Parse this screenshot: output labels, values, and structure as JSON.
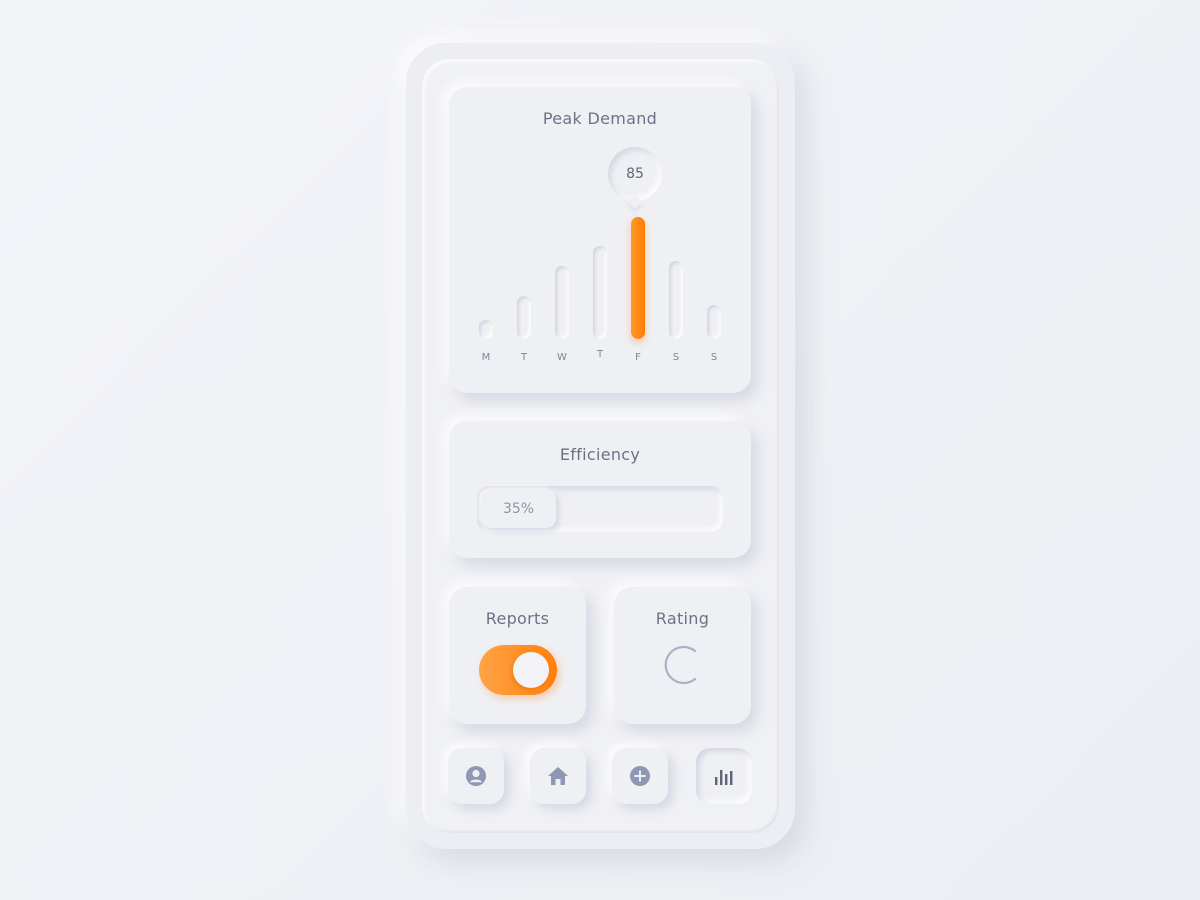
{
  "colors": {
    "accent": "#ff8410",
    "background": "#eff0f4",
    "text": "#6c7286",
    "icon": "#8f97b4",
    "icon_active": "#5f6578"
  },
  "peak_demand": {
    "title": "Peak Demand",
    "highlight_value": "85",
    "highlight_day_index": 4
  },
  "chart_data": {
    "type": "bar",
    "title": "Peak Demand",
    "categories": [
      "M",
      "T",
      "W",
      "T",
      "F",
      "S",
      "S"
    ],
    "values": [
      13,
      30,
      51,
      65,
      85,
      54,
      24
    ],
    "highlight": {
      "category_index": 4,
      "label": "85"
    },
    "xlabel": "",
    "ylabel": "",
    "ylim": [
      0,
      85
    ],
    "grid": false
  },
  "efficiency": {
    "title": "Efficiency",
    "value_label": "35%",
    "value": 0.35
  },
  "reports": {
    "title": "Reports",
    "toggle_on": true
  },
  "rating": {
    "title": "Rating",
    "icon": "loading-arc-icon"
  },
  "nav": {
    "items": [
      {
        "name": "profile",
        "icon": "user-circle-icon",
        "active": false
      },
      {
        "name": "home",
        "icon": "home-icon",
        "active": false
      },
      {
        "name": "add",
        "icon": "plus-circle-icon",
        "active": false
      },
      {
        "name": "stats",
        "icon": "bar-chart-icon",
        "active": true
      }
    ]
  }
}
